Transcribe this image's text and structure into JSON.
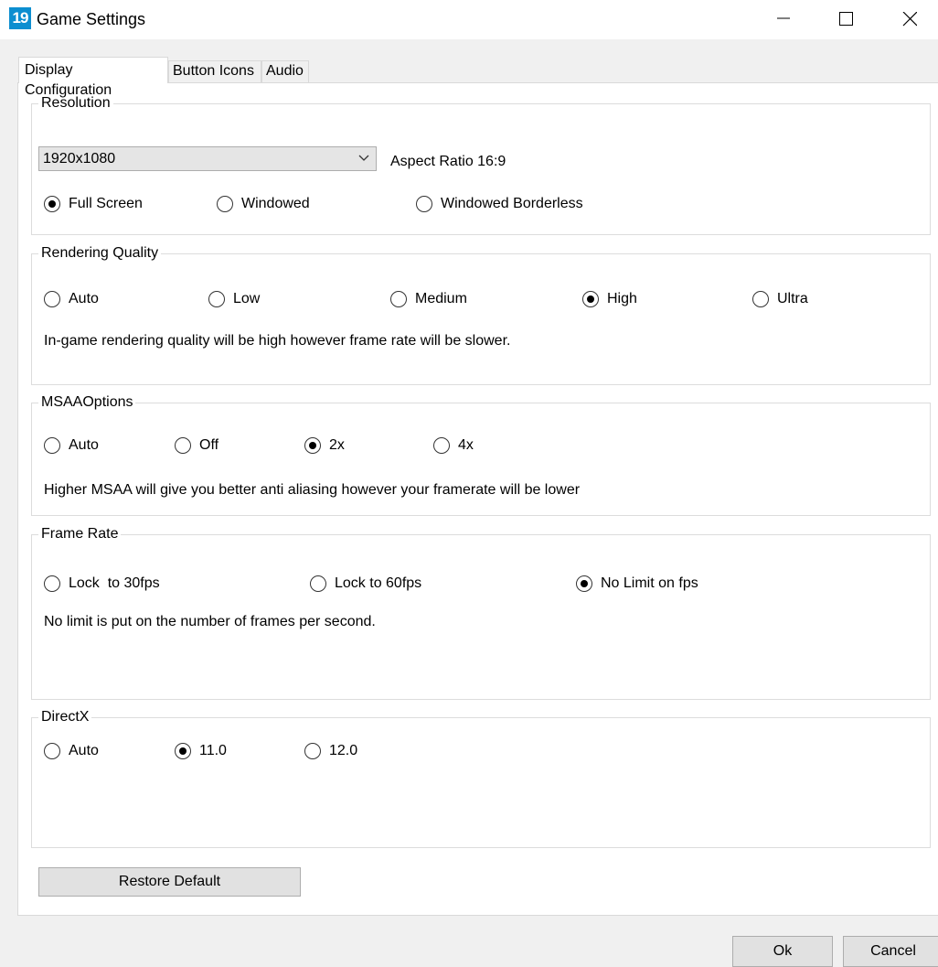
{
  "window": {
    "icon_text": "19",
    "title": "Game Settings",
    "icons": [
      "minimize-icon",
      "maximize-icon",
      "close-icon"
    ]
  },
  "tabs": [
    {
      "label": "Display Configuration",
      "active": true
    },
    {
      "label": "Button Icons",
      "active": false
    },
    {
      "label": "Audio",
      "active": false
    }
  ],
  "resolution": {
    "label": "Resolution",
    "selected": "1920x1080",
    "aspect_ratio": "Aspect Ratio 16:9",
    "modes": [
      {
        "label": "Full Screen",
        "checked": true
      },
      {
        "label": "Windowed",
        "checked": false
      },
      {
        "label": "Windowed Borderless",
        "checked": false
      }
    ]
  },
  "rendering_quality": {
    "label": "Rendering Quality",
    "options": [
      {
        "label": "Auto",
        "checked": false
      },
      {
        "label": "Low",
        "checked": false
      },
      {
        "label": "Medium",
        "checked": false
      },
      {
        "label": "High",
        "checked": true
      },
      {
        "label": "Ultra",
        "checked": false
      }
    ],
    "description": "In-game rendering quality will be high however frame rate will be slower."
  },
  "msaa": {
    "label": "MSAAOptions",
    "options": [
      {
        "label": "Auto",
        "checked": false
      },
      {
        "label": "Off",
        "checked": false
      },
      {
        "label": "2x",
        "checked": true
      },
      {
        "label": "4x",
        "checked": false
      }
    ],
    "description": "Higher MSAA will give you better anti aliasing however your framerate will be lower"
  },
  "frame_rate": {
    "label": "Frame Rate",
    "options": [
      {
        "label": "Lock  to 30fps",
        "checked": false
      },
      {
        "label": "Lock to 60fps",
        "checked": false
      },
      {
        "label": "No Limit on fps",
        "checked": true
      }
    ],
    "description": "No limit is put on the number of frames per second."
  },
  "directx": {
    "label": "DirectX",
    "options": [
      {
        "label": "Auto",
        "checked": false
      },
      {
        "label": "11.0",
        "checked": true
      },
      {
        "label": "12.0",
        "checked": false
      }
    ]
  },
  "buttons": {
    "restore": "Restore Default",
    "ok": "Ok",
    "cancel": "Cancel"
  }
}
